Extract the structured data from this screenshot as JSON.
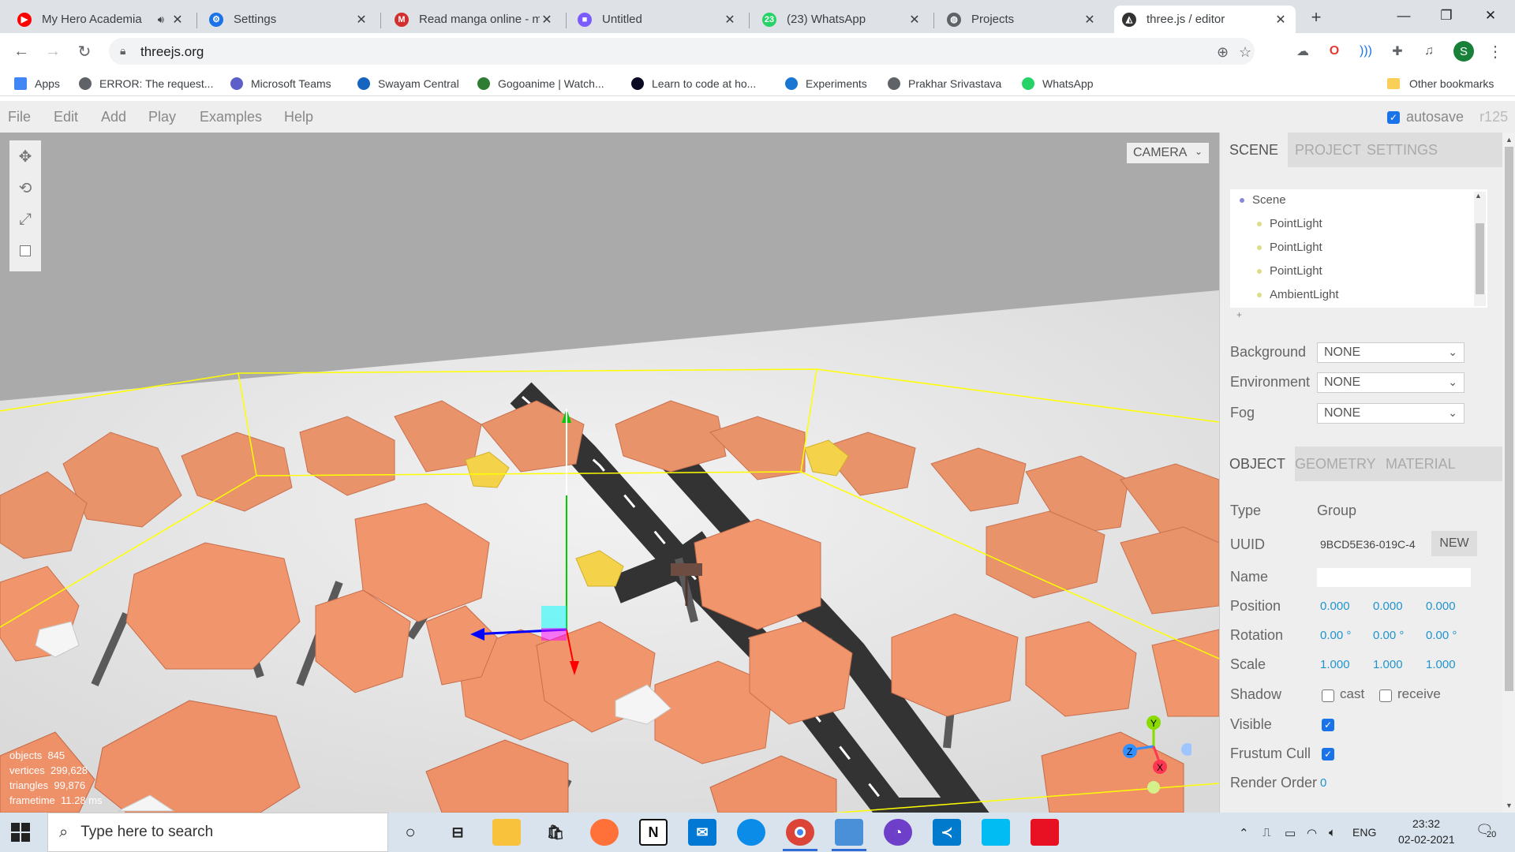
{
  "browser": {
    "tabs": [
      {
        "title": "My Hero Academia",
        "icon": "youtube-icon",
        "color": "#ff0000",
        "glyph": "▶",
        "audio": true
      },
      {
        "title": "Settings",
        "icon": "gear-icon",
        "color": "#1a73e8",
        "glyph": "⚙"
      },
      {
        "title": "Read manga online - m",
        "icon": "manga-icon",
        "color": "#d32f2f",
        "glyph": "M"
      },
      {
        "title": "Untitled",
        "icon": "figma-icon",
        "color": "#7b5cff",
        "glyph": "■"
      },
      {
        "title": "(23) WhatsApp",
        "icon": "whatsapp-icon",
        "color": "#25d366",
        "glyph": "23"
      },
      {
        "title": "Projects",
        "icon": "globe-icon",
        "color": "#5f6368",
        "glyph": "◍"
      },
      {
        "title": "three.js / editor",
        "icon": "threejs-icon",
        "color": "#333333",
        "glyph": "◭"
      }
    ],
    "new_tab_glyph": "+",
    "close_glyph": "✕",
    "url": "threejs.org",
    "profile_initial": "S",
    "bookmarks": [
      {
        "label": "Apps",
        "icon": "apps-grid-icon",
        "color": "#4285f4"
      },
      {
        "label": "ERROR: The request...",
        "icon": "globe-icon",
        "color": "#5f6368"
      },
      {
        "label": "Microsoft Teams",
        "icon": "teams-icon",
        "color": "#5b5fc7"
      },
      {
        "label": "Swayam Central",
        "icon": "swayam-icon",
        "color": "#1565c0"
      },
      {
        "label": "Gogoanime | Watch...",
        "icon": "gogoanime-icon",
        "color": "#2e7d32"
      },
      {
        "label": "Learn to code at ho...",
        "icon": "freecodecamp-icon",
        "color": "#0a0a23"
      },
      {
        "label": "Experiments",
        "icon": "flask-icon",
        "color": "#1976d2"
      },
      {
        "label": "Prakhar Srivastava",
        "icon": "globe-icon",
        "color": "#5f6368"
      },
      {
        "label": "WhatsApp",
        "icon": "whatsapp-icon",
        "color": "#25d366"
      }
    ],
    "other_bookmarks": "Other bookmarks"
  },
  "editor": {
    "menu": [
      "File",
      "Edit",
      "Add",
      "Play",
      "Examples",
      "Help"
    ],
    "autosave_label": "autosave",
    "autosave_checked": true,
    "version": "r125",
    "camera_select": "CAMERA",
    "viewport_info": [
      {
        "label": "objects",
        "value": "845"
      },
      {
        "label": "vertices",
        "value": "299,628"
      },
      {
        "label": "triangles",
        "value": "99,876"
      },
      {
        "label": "frametime",
        "value": "11.28 ms"
      }
    ],
    "gizmo_axes": [
      "Y",
      "Z",
      "X"
    ],
    "sidebar_tabs": [
      "SCENE",
      "PROJECT",
      "SETTINGS"
    ],
    "outliner": [
      {
        "label": "Scene",
        "level": 0
      },
      {
        "label": "PointLight",
        "level": 1
      },
      {
        "label": "PointLight",
        "level": 1
      },
      {
        "label": "PointLight",
        "level": 1
      },
      {
        "label": "AmbientLight",
        "level": 1
      }
    ],
    "scene_props": [
      {
        "label": "Background",
        "value": "NONE"
      },
      {
        "label": "Environment",
        "value": "NONE"
      },
      {
        "label": "Fog",
        "value": "NONE"
      }
    ],
    "object_tabs": [
      "OBJECT",
      "GEOMETRY",
      "MATERIAL"
    ],
    "object": {
      "type_label": "Type",
      "type_value": "Group",
      "uuid_label": "UUID",
      "uuid_value": "9BCD5E36-019C-4",
      "new_button": "NEW",
      "name_label": "Name",
      "name_value": "",
      "position_label": "Position",
      "position": [
        "0.000",
        "0.000",
        "0.000"
      ],
      "rotation_label": "Rotation",
      "rotation": [
        "0.00 °",
        "0.00 °",
        "0.00 °"
      ],
      "scale_label": "Scale",
      "scale": [
        "1.000",
        "1.000",
        "1.000"
      ],
      "shadow_label": "Shadow",
      "cast_label": "cast",
      "receive_label": "receive",
      "visible_label": "Visible",
      "frustum_label": "Frustum Cull",
      "render_order_label": "Render Order",
      "render_order": "0"
    }
  },
  "taskbar": {
    "search_placeholder": "Type here to search",
    "language": "ENG",
    "time": "23:32",
    "date": "02-02-2021",
    "notification_count": "20"
  }
}
